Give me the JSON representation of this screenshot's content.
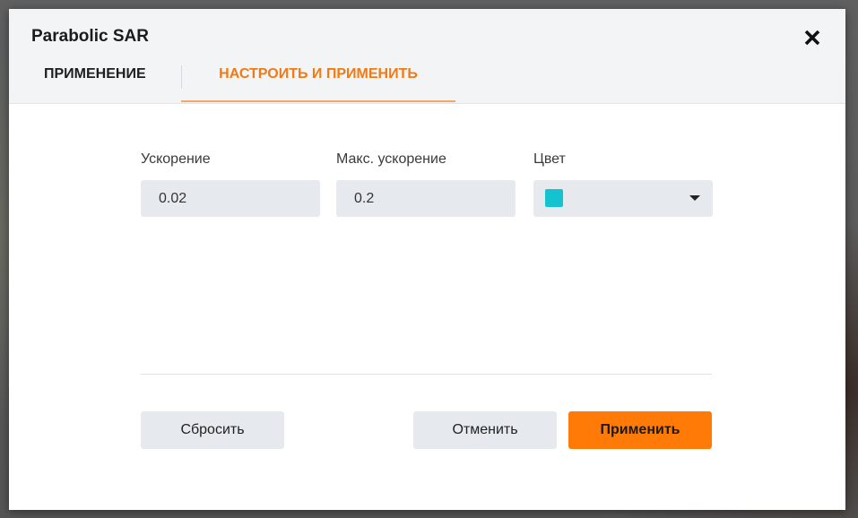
{
  "dialog": {
    "title": "Parabolic SAR",
    "close_icon": "close-icon"
  },
  "tabs": [
    {
      "label": "ПРИМЕНЕНИЕ",
      "active": false
    },
    {
      "label": "НАСТРОИТЬ И ПРИМЕНИТЬ",
      "active": true
    }
  ],
  "fields": {
    "acceleration": {
      "label": "Ускорение",
      "value": "0.02"
    },
    "max_acceleration": {
      "label": "Макс. ускорение",
      "value": "0.2"
    },
    "color": {
      "label": "Цвет",
      "value": "#14c3cf",
      "icon": "chevron-down-icon"
    }
  },
  "buttons": {
    "reset": "Сбросить",
    "cancel": "Отменить",
    "apply": "Применить"
  },
  "colors": {
    "accent": "#f07a13",
    "primary_button": "#ff7a07",
    "input_bg": "#e6eaee"
  }
}
